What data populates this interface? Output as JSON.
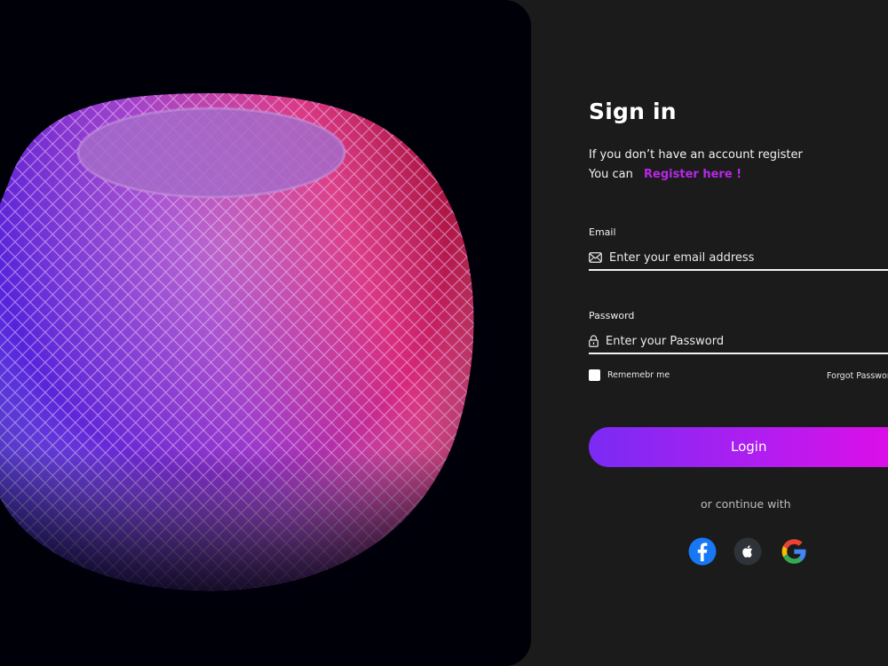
{
  "colors": {
    "background": "#1b1b1b",
    "hero_background": "#000009",
    "accent_link": "#b927e6",
    "button_gradient": [
      "#7a2bf4",
      "#e30ce6"
    ]
  },
  "signin": {
    "title": "Sign in",
    "subtitle": "If you don’t have an account register",
    "register_prefix": "You can",
    "register_link": "Register here !"
  },
  "email": {
    "label": "Email",
    "placeholder": "Enter your email address",
    "icon": "mail-icon"
  },
  "password": {
    "label": "Password",
    "placeholder": "Enter your Password",
    "icon": "lock-icon"
  },
  "remember_label": "Rememebr me",
  "forgot_label": "Forgot Password ?",
  "login_label": "Login",
  "divider_text": "or continue with",
  "social": [
    "facebook-icon",
    "apple-icon",
    "google-icon"
  ]
}
